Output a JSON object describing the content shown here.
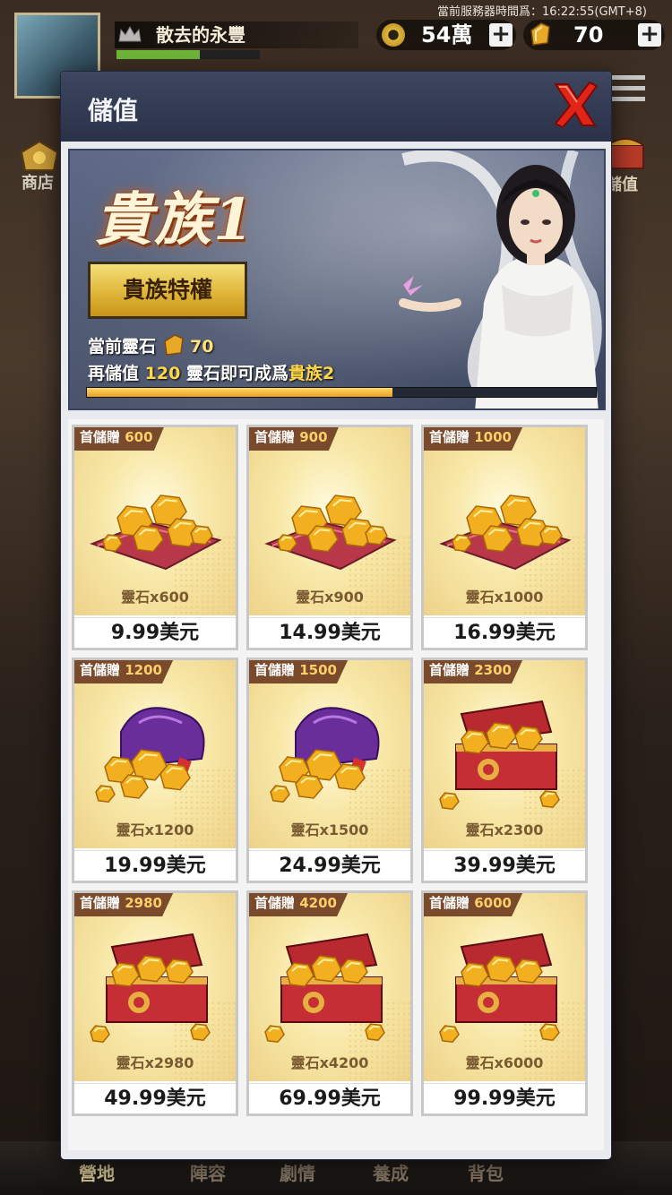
{
  "hud": {
    "server_time": "當前服務器時間爲：16:22:55(GMT+8)",
    "player_name": "散去的永豐",
    "gold": "54萬",
    "spirit_stone": "70",
    "plus": "+",
    "shop_label": "商店",
    "recharge_label": "儲值"
  },
  "bottom_nav": [
    "營地",
    "陣容",
    "劇情",
    "養成",
    "背包"
  ],
  "modal": {
    "title": "儲值",
    "banner": {
      "rank_title": "貴族1",
      "privilege_button": "貴族特權",
      "current_stone_label": "當前靈石",
      "current_stone_value": "70",
      "upgrade_prefix": "再儲值",
      "upgrade_amount": "120",
      "upgrade_middle": "靈石即可成爲",
      "upgrade_target": "貴族2",
      "progress_fraction": 0.6
    },
    "packages": [
      {
        "bonus_label": "首儲贈",
        "bonus": "600",
        "qty": "靈石x600",
        "price": "9.99美元",
        "art": "pile"
      },
      {
        "bonus_label": "首儲贈",
        "bonus": "900",
        "qty": "靈石x900",
        "price": "14.99美元",
        "art": "pile"
      },
      {
        "bonus_label": "首儲贈",
        "bonus": "1000",
        "qty": "靈石x1000",
        "price": "16.99美元",
        "art": "pile"
      },
      {
        "bonus_label": "首儲贈",
        "bonus": "1200",
        "qty": "靈石x1200",
        "price": "19.99美元",
        "art": "bag"
      },
      {
        "bonus_label": "首儲贈",
        "bonus": "1500",
        "qty": "靈石x1500",
        "price": "24.99美元",
        "art": "bag"
      },
      {
        "bonus_label": "首儲贈",
        "bonus": "2300",
        "qty": "靈石x2300",
        "price": "39.99美元",
        "art": "chest"
      },
      {
        "bonus_label": "首儲贈",
        "bonus": "2980",
        "qty": "靈石x2980",
        "price": "49.99美元",
        "art": "chest"
      },
      {
        "bonus_label": "首儲贈",
        "bonus": "4200",
        "qty": "靈石x4200",
        "price": "69.99美元",
        "art": "chest"
      },
      {
        "bonus_label": "首儲贈",
        "bonus": "6000",
        "qty": "靈石x6000",
        "price": "99.99美元",
        "art": "chest"
      }
    ]
  },
  "colors": {
    "header": "#2a3148",
    "ribbon": "#7a4a2c",
    "gold": "#e0b63a",
    "close": "#d82020"
  },
  "icons": {
    "close": "close-x-icon",
    "gold": "coin-icon",
    "stone": "spirit-stone-icon",
    "menu": "hamburger-menu-icon",
    "crown": "crown-icon"
  }
}
